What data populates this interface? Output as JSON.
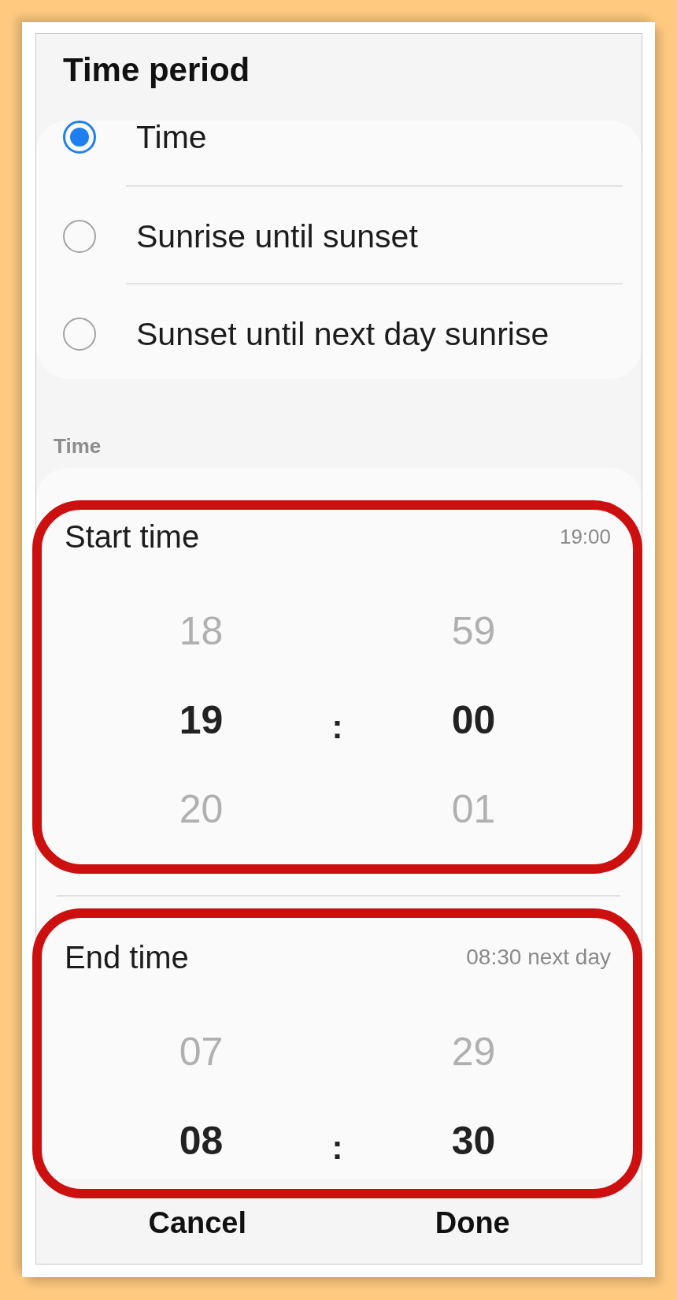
{
  "dialog": {
    "title": "Time period"
  },
  "period_options": [
    {
      "label": "Time",
      "selected": true
    },
    {
      "label": "Sunrise until sunset",
      "selected": false
    },
    {
      "label": "Sunset until next day sunrise",
      "selected": false
    }
  ],
  "time_section": {
    "label": "Time"
  },
  "time_pickers": [
    {
      "label": "Start time",
      "summary": "19:00",
      "highlighted": true,
      "separator": ":",
      "hours": [
        {
          "value": "18",
          "selected": false
        },
        {
          "value": "19",
          "selected": true
        },
        {
          "value": "20",
          "selected": false
        }
      ],
      "minutes": [
        {
          "value": "59",
          "selected": false
        },
        {
          "value": "00",
          "selected": true
        },
        {
          "value": "01",
          "selected": false
        }
      ]
    },
    {
      "label": "End time",
      "summary": "08:30 next day",
      "highlighted": true,
      "separator": ":",
      "hours": [
        {
          "value": "07",
          "selected": false
        },
        {
          "value": "08",
          "selected": true
        }
      ],
      "minutes": [
        {
          "value": "29",
          "selected": false
        },
        {
          "value": "30",
          "selected": true
        }
      ]
    }
  ],
  "buttons": [
    {
      "label": "Cancel"
    },
    {
      "label": "Done"
    }
  ]
}
